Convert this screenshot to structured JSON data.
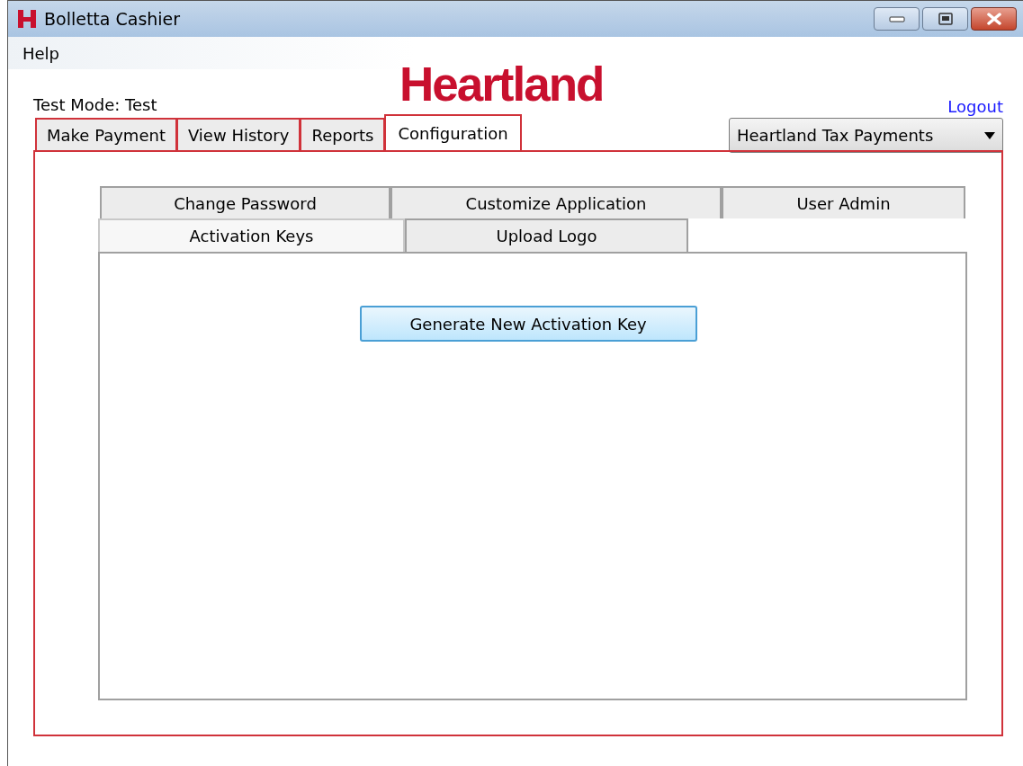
{
  "window": {
    "title": "Bolletta Cashier"
  },
  "menu": [
    "Help"
  ],
  "test_mode": "Test Mode: Test",
  "logo": "Heartland",
  "logout": "Logout",
  "account_dropdown": {
    "value": "Heartland Tax Payments"
  },
  "tabs": [
    {
      "label": "Make Payment",
      "selected": false
    },
    {
      "label": "View History",
      "selected": false
    },
    {
      "label": "Reports",
      "selected": false
    },
    {
      "label": "Configuration",
      "selected": true
    }
  ],
  "sub_tabs": [
    [
      {
        "label": "Change Password",
        "selected": false
      },
      {
        "label": "Customize Application",
        "selected": false
      },
      {
        "label": "User Admin",
        "selected": false
      }
    ],
    [
      {
        "label": "Activation Keys",
        "selected": true
      },
      {
        "label": "Upload Logo",
        "selected": false
      }
    ]
  ],
  "button": "Generate New Activation Key"
}
